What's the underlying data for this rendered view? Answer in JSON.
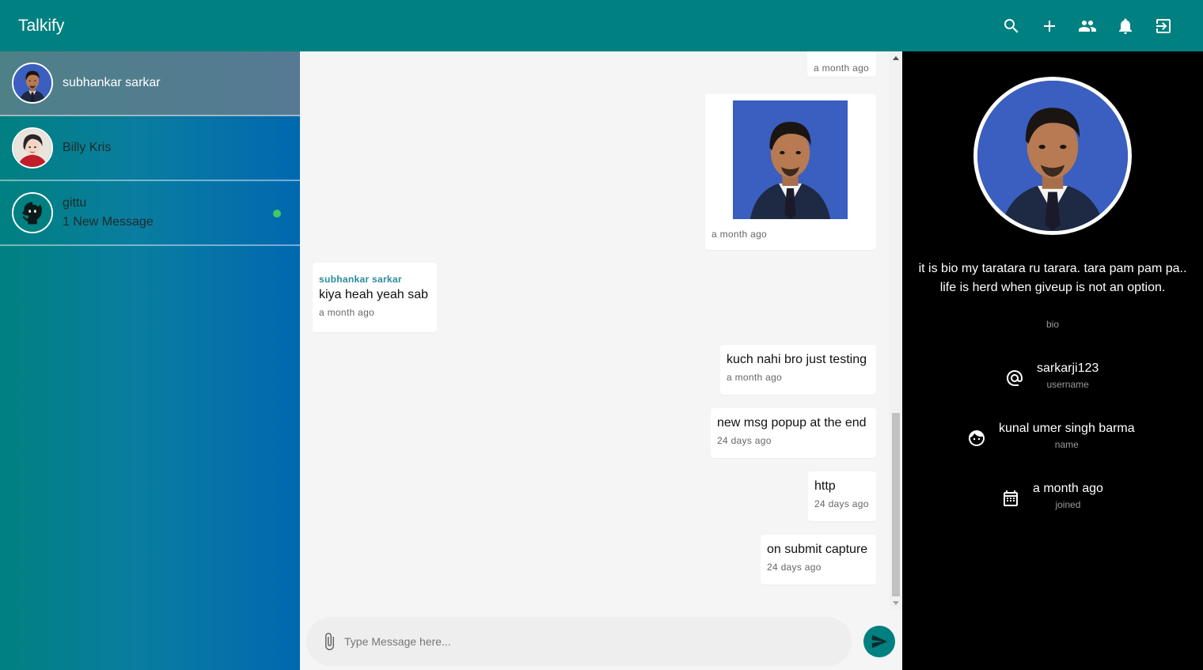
{
  "app": {
    "title": "Talkify"
  },
  "header": {
    "actions": [
      {
        "icon": "search-icon"
      },
      {
        "icon": "add-icon"
      },
      {
        "icon": "people-icon"
      },
      {
        "icon": "bell-icon"
      },
      {
        "icon": "logout-icon"
      }
    ]
  },
  "sidebar": {
    "chats": [
      {
        "name": "subhankar sarkar",
        "subtitle": "",
        "online": false
      },
      {
        "name": "Billy Kris",
        "subtitle": "",
        "online": false
      },
      {
        "name": "gittu",
        "subtitle": "1 New Message",
        "online": true
      }
    ]
  },
  "chat": {
    "messages": [
      {
        "side": "right",
        "text": "",
        "time": "a month ago"
      },
      {
        "side": "right",
        "image": true,
        "time": "a month ago"
      },
      {
        "side": "left",
        "sender": "subhankar sarkar",
        "text": "kiya heah yeah sab",
        "time": "a month ago"
      },
      {
        "side": "right",
        "text": "kuch nahi bro just testing",
        "time": "a month ago"
      },
      {
        "side": "right",
        "text": "new msg popup at the end",
        "time": "24 days ago"
      },
      {
        "side": "right",
        "text": "http",
        "time": "24 days ago"
      },
      {
        "side": "right",
        "text": "on submit capture",
        "time": "24 days ago"
      }
    ],
    "composer": {
      "placeholder": "Type Message here..."
    }
  },
  "profile": {
    "bio": "it is bio my taratara ru tarara. tara pam pam pa.. life is herd when giveup is not an option.",
    "bio_label": "bio",
    "username": "sarkarji123",
    "username_label": "username",
    "name": "kunal umer singh barma",
    "name_label": "name",
    "joined": "a month ago",
    "joined_label": "joined"
  },
  "colors": {
    "primary": "#008080",
    "online": "#44c767",
    "sender": "#2a8a9c",
    "profile_bg": "#000000"
  }
}
